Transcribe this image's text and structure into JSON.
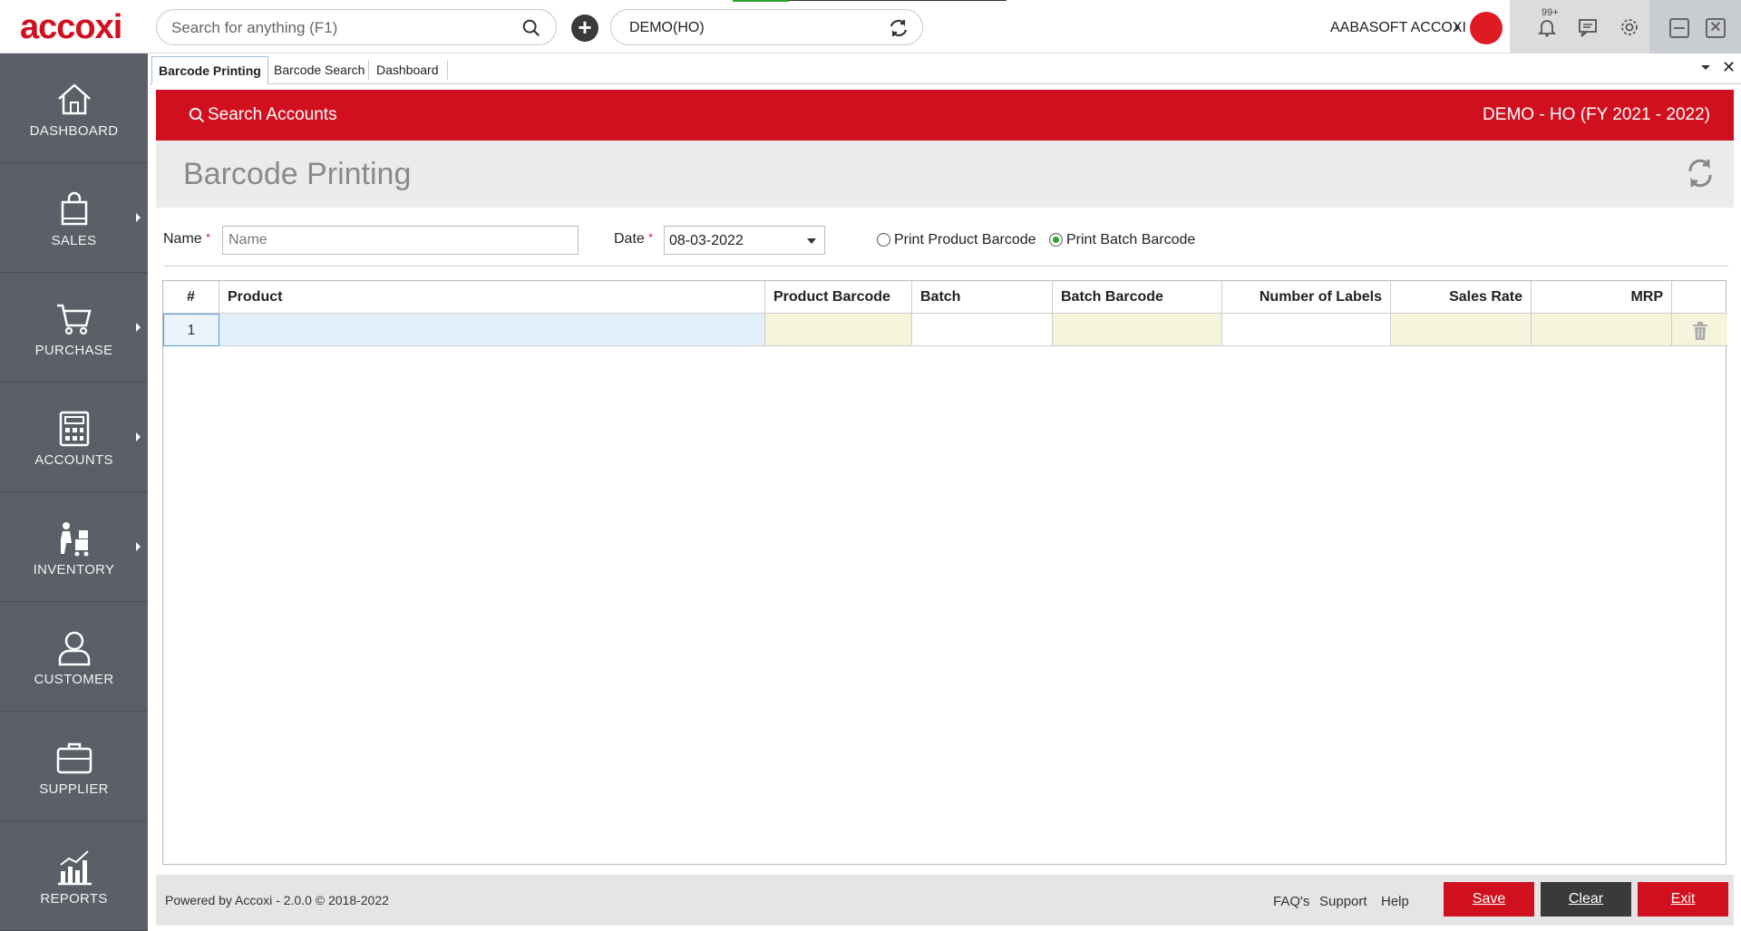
{
  "app": {
    "logo": "accoxi"
  },
  "topbar": {
    "search_placeholder": "Search for anything (F1)",
    "branch": "DEMO(HO)",
    "user": "AABASOFT ACCOXI",
    "notification_badge": "99+"
  },
  "sidebar": {
    "items": [
      {
        "label": "DASHBOARD",
        "icon": "home-icon",
        "has_arrow": false
      },
      {
        "label": "SALES",
        "icon": "shopping-bag-icon",
        "has_arrow": true
      },
      {
        "label": "PURCHASE",
        "icon": "cart-icon",
        "has_arrow": true
      },
      {
        "label": "ACCOUNTS",
        "icon": "calculator-icon",
        "has_arrow": true
      },
      {
        "label": "INVENTORY",
        "icon": "inventory-icon",
        "has_arrow": true
      },
      {
        "label": "CUSTOMER",
        "icon": "user-icon",
        "has_arrow": false
      },
      {
        "label": "SUPPLIER",
        "icon": "briefcase-icon",
        "has_arrow": false
      },
      {
        "label": "REPORTS",
        "icon": "chart-icon",
        "has_arrow": false
      }
    ]
  },
  "tabs": [
    {
      "label": "Barcode Printing",
      "active": true
    },
    {
      "label": "Barcode Search",
      "active": false
    },
    {
      "label": "Dashboard",
      "active": false
    }
  ],
  "header": {
    "search_accounts": "Search Accounts",
    "company": "DEMO - HO (FY 2021 - 2022)"
  },
  "page": {
    "title": "Barcode Printing"
  },
  "form": {
    "name_label": "Name",
    "name_placeholder": "Name",
    "name_value": "",
    "required_mark": "*",
    "date_label": "Date",
    "date_value": "08-03-2022",
    "radio_product": "Print Product Barcode",
    "radio_batch": "Print Batch Barcode",
    "selected_radio": "batch"
  },
  "grid": {
    "columns": [
      "#",
      "Product",
      "Product Barcode",
      "Batch",
      "Batch Barcode",
      "Number of Labels",
      "Sales Rate",
      "MRP",
      ""
    ],
    "rows": [
      {
        "num": "1",
        "product": "",
        "product_barcode": "",
        "batch": "",
        "batch_barcode": "",
        "labels": "",
        "sales_rate": "",
        "mrp": ""
      }
    ]
  },
  "footer": {
    "powered": "Powered by Accoxi - 2.0.0 © 2018-2022",
    "links": [
      "FAQ's",
      "Support",
      "Help"
    ],
    "save": "Save",
    "clear": "Clear",
    "exit": "Exit"
  },
  "colors": {
    "brand_red": "#d0101e",
    "sidebar": "#5b6068",
    "accent_green": "#2aa52a"
  }
}
